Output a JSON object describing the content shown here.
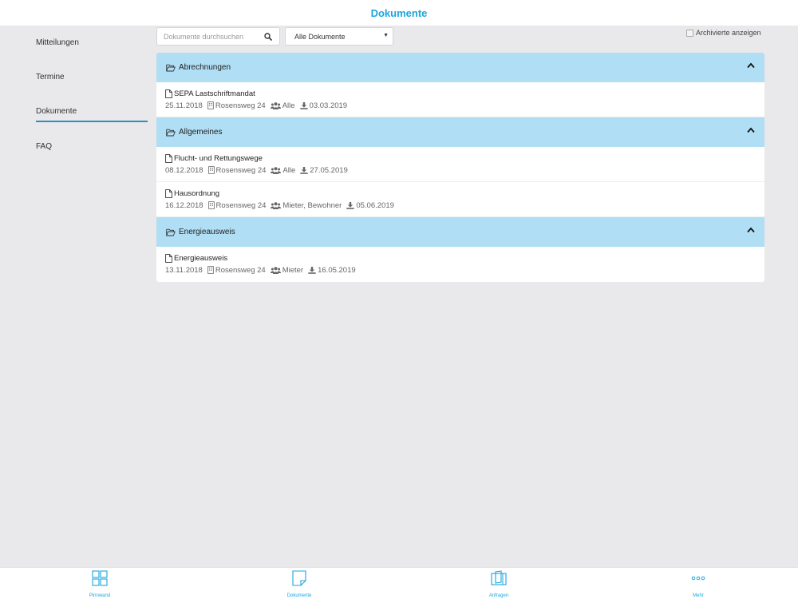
{
  "header": {
    "title": "Dokumente"
  },
  "sidebar": {
    "items": [
      {
        "label": "Mitteilungen"
      },
      {
        "label": "Termine"
      },
      {
        "label": "Dokumente",
        "active": true
      },
      {
        "label": "FAQ"
      }
    ]
  },
  "toolbar": {
    "search_placeholder": "Dokumente durchsuchen",
    "filter_value": "Alle Dokumente",
    "archived_label": "Archivierte anzeigen"
  },
  "groups": [
    {
      "name": "Abrechnungen",
      "docs": [
        {
          "name": "SEPA Lastschriftmandat",
          "date": "25.11.2018",
          "building": "Rosensweg 24",
          "audience": "Alle",
          "download": "03.03.2019"
        }
      ]
    },
    {
      "name": "Allgemeines",
      "docs": [
        {
          "name": "Flucht- und Rettungswege",
          "date": "08.12.2018",
          "building": "Rosensweg 24",
          "audience": "Alle",
          "download": "27.05.2019"
        },
        {
          "name": "Hausordnung",
          "date": "16.12.2018",
          "building": "Rosensweg 24",
          "audience": "Mieter, Bewohner",
          "download": "05.06.2019"
        }
      ]
    },
    {
      "name": "Energieausweis",
      "docs": [
        {
          "name": "Energieausweis",
          "date": "13.11.2018",
          "building": "Rosensweg 24",
          "audience": "Mieter",
          "download": "16.05.2019"
        }
      ]
    }
  ],
  "tabbar": {
    "tabs": [
      {
        "label": "Pinnwand",
        "icon": "grid-icon"
      },
      {
        "label": "Dokumente",
        "icon": "document-icon"
      },
      {
        "label": "Anfragen",
        "icon": "inquiry-icon"
      },
      {
        "label": "Mehr",
        "icon": "more-icon"
      }
    ]
  },
  "colors": {
    "accent": "#1aa6e0",
    "group_header": "#b0def4",
    "background": "#e9e8ea"
  }
}
